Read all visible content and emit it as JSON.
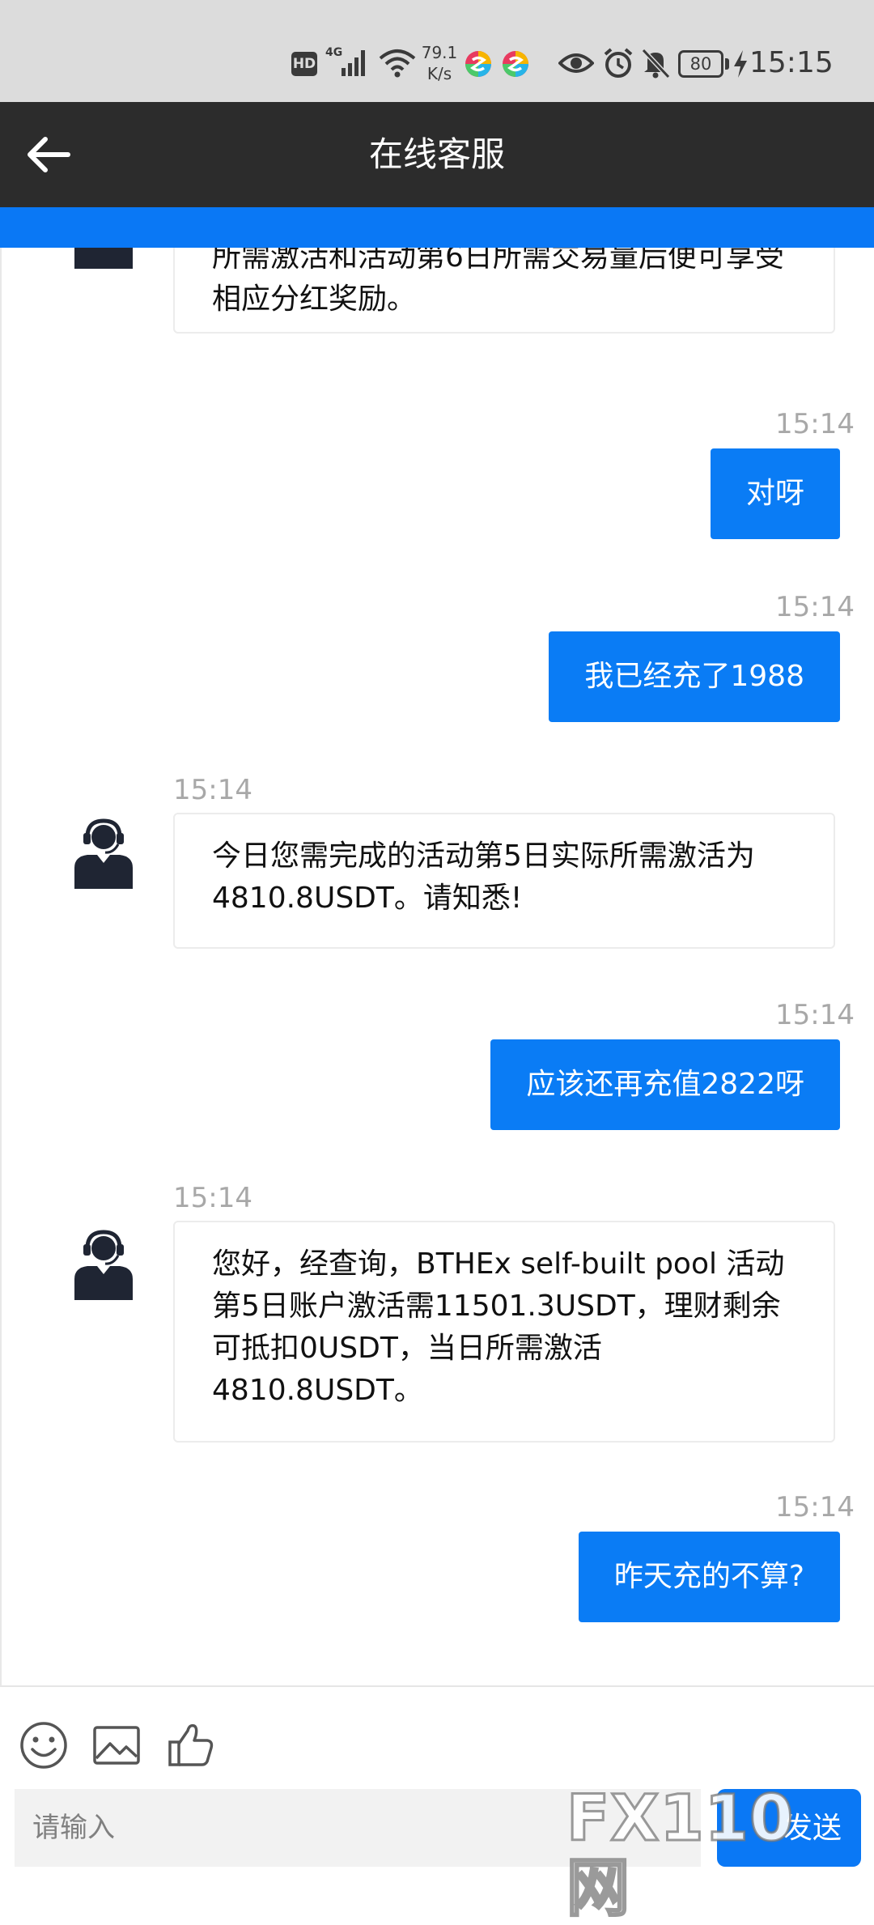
{
  "status_bar": {
    "hd_label": "HD",
    "network_type": "4G",
    "speed_value": "79.1",
    "speed_unit": "K/s",
    "battery_level": "80",
    "time": "15:15"
  },
  "header": {
    "title": "在线客服"
  },
  "messages": [
    {
      "side": "in",
      "time": "",
      "text": "所需激活和活动第6日所需交易量后便可享受相应分红奖励。"
    },
    {
      "side": "out",
      "time": "15:14",
      "text": "对呀"
    },
    {
      "side": "out",
      "time": "15:14",
      "text": "我已经充了1988"
    },
    {
      "side": "in",
      "time": "15:14",
      "text": "今日您需完成的活动第5日实际所需激活为4810.8USDT。请知悉!"
    },
    {
      "side": "out",
      "time": "15:14",
      "text": "应该还再充值2822呀"
    },
    {
      "side": "in",
      "time": "15:14",
      "text": "您好，经查询，BTHEx self-built pool 活动第5日账户激活需11501.3USDT，理财剩余可抵扣0USDT，当日所需激活4810.8USDT。"
    },
    {
      "side": "out",
      "time": "15:14",
      "text": "昨天充的不算?"
    }
  ],
  "toolbar": {
    "icons": [
      "emoji-icon",
      "image-icon",
      "like-icon"
    ]
  },
  "input": {
    "placeholder": "请输入",
    "value": ""
  },
  "send_button": {
    "label": "发送"
  },
  "watermark": {
    "text": "FX110网"
  },
  "colors": {
    "header_bg": "#2c2c2c",
    "accent_blue": "#0a78f5",
    "status_bar_bg": "#dcdcdc",
    "timestamp_gray": "#a8a8a8"
  }
}
